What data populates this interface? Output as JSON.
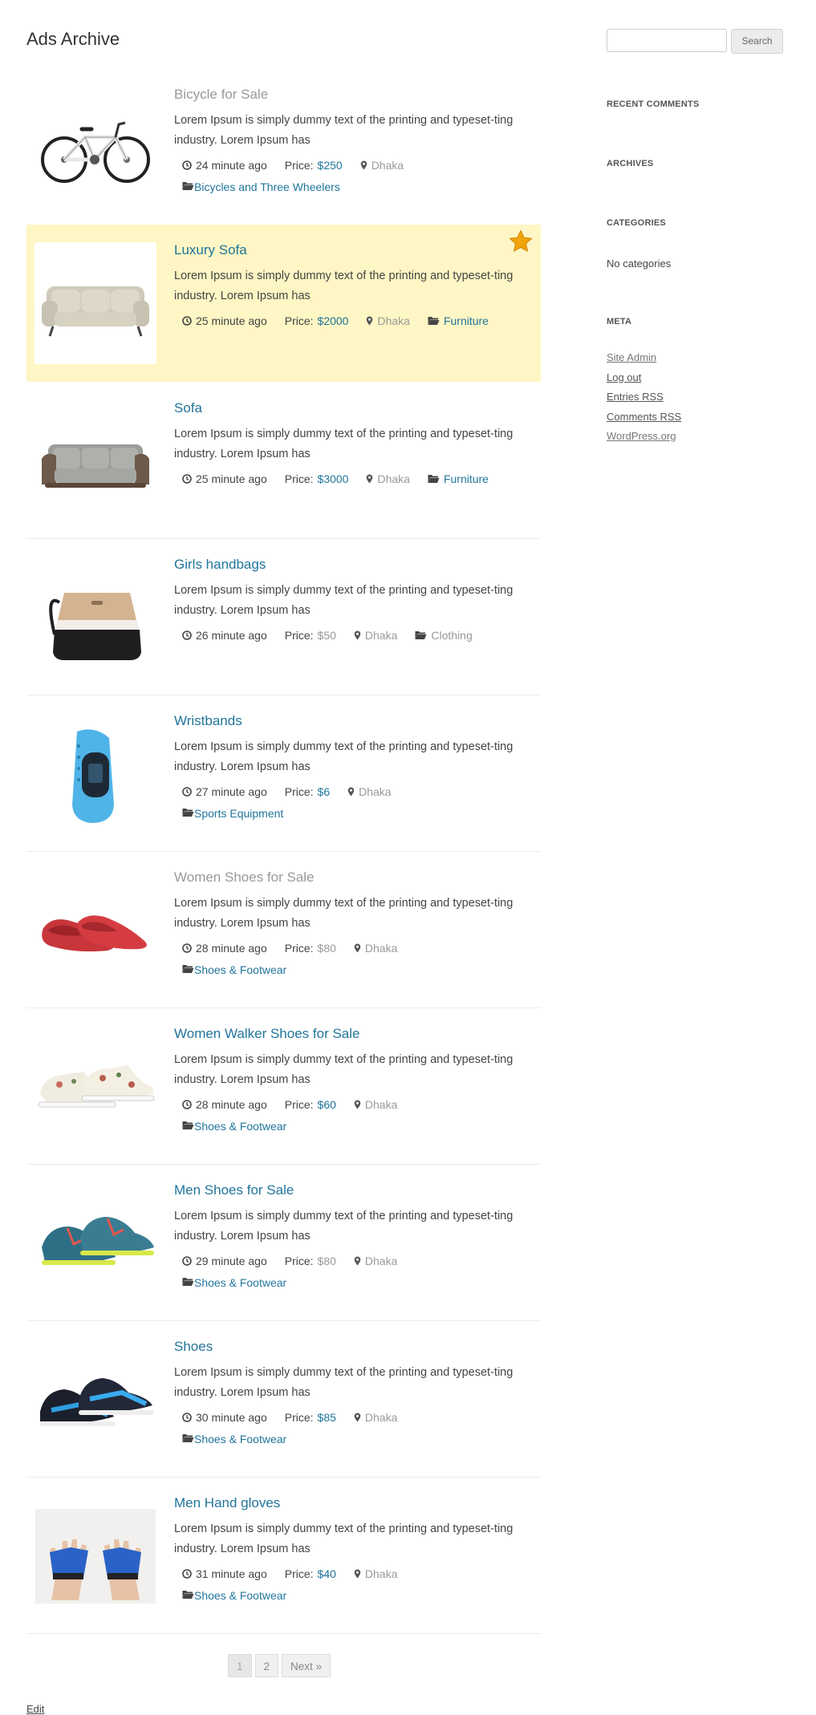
{
  "page": {
    "title": "Ads Archive",
    "edit_label": "Edit"
  },
  "colors": {
    "link": "#21759b",
    "featured_bg": "#fef6c4",
    "muted": "#999999",
    "star": "#f0a30a"
  },
  "ads": [
    {
      "title": "Bicycle for Sale",
      "title_muted": true,
      "image": "bicycle",
      "excerpt": "Lorem Ipsum is simply dummy text of the printing and typeset-ting industry. Lorem Ipsum has",
      "time": "24 minute ago",
      "price_label": "Price:",
      "price": "$250",
      "location": "Dhaka",
      "category": "Bicycles and Three Wheelers",
      "category_wrapped": true,
      "featured": false
    },
    {
      "title": "Luxury Sofa",
      "title_muted": false,
      "image": "sofa-beige",
      "excerpt": "Lorem Ipsum is simply dummy text of the printing and typeset-ting industry. Lorem Ipsum has",
      "time": "25 minute ago",
      "price_label": "Price:",
      "price": "$2000",
      "location": "Dhaka",
      "category": "Furniture",
      "category_wrapped": false,
      "featured": true
    },
    {
      "title": "Sofa",
      "title_muted": false,
      "image": "sofa-grey",
      "excerpt": "Lorem Ipsum is simply dummy text of the printing and typeset-ting industry. Lorem Ipsum has",
      "time": "25 minute ago",
      "price_label": "Price:",
      "price": "$3000",
      "location": "Dhaka",
      "category": "Furniture",
      "category_wrapped": false,
      "featured": false
    },
    {
      "title": "Girls handbags",
      "title_muted": false,
      "image": "handbag",
      "excerpt": "Lorem Ipsum is simply dummy text of the printing and typeset-ting industry. Lorem Ipsum has",
      "time": "26 minute ago",
      "price_label": "Price:",
      "price": "$50",
      "price_muted": true,
      "location": "Dhaka",
      "category": "Clothing",
      "category_muted": true,
      "category_wrapped": false,
      "featured": false
    },
    {
      "title": "Wristbands",
      "title_muted": false,
      "image": "wristband",
      "excerpt": "Lorem Ipsum is simply dummy text of the printing and typeset-ting industry. Lorem Ipsum has",
      "time": "27 minute ago",
      "price_label": "Price:",
      "price": "$6",
      "location": "Dhaka",
      "category": "Sports Equipment",
      "category_wrapped": true,
      "featured": false
    },
    {
      "title": "Women Shoes for Sale",
      "title_muted": true,
      "image": "shoes-red",
      "excerpt": "Lorem Ipsum is simply dummy text of the printing and typeset-ting industry. Lorem Ipsum has",
      "time": "28 minute ago",
      "price_label": "Price:",
      "price": "$80",
      "price_muted": true,
      "location": "Dhaka",
      "category": "Shoes & Footwear",
      "category_wrapped": true,
      "featured": false
    },
    {
      "title": "Women Walker Shoes for Sale",
      "title_muted": false,
      "image": "shoes-floral",
      "excerpt": "Lorem Ipsum is simply dummy text of the printing and typeset-ting industry. Lorem Ipsum has",
      "time": "28 minute ago",
      "price_label": "Price:",
      "price": "$60",
      "location": "Dhaka",
      "category": "Shoes & Footwear",
      "category_wrapped": true,
      "featured": false
    },
    {
      "title": "Men Shoes for Sale",
      "title_muted": false,
      "image": "shoes-sport",
      "excerpt": "Lorem Ipsum is simply dummy text of the printing and typeset-ting industry. Lorem Ipsum has",
      "time": "29 minute ago",
      "price_label": "Price:",
      "price": "$80",
      "price_muted": true,
      "location": "Dhaka",
      "category": "Shoes & Footwear",
      "category_wrapped": true,
      "featured": false
    },
    {
      "title": "Shoes",
      "title_muted": false,
      "image": "shoes-blue",
      "excerpt": "Lorem Ipsum is simply dummy text of the printing and typeset-ting industry. Lorem Ipsum has",
      "time": "30 minute ago",
      "price_label": "Price:",
      "price": "$85",
      "location": "Dhaka",
      "category": "Shoes & Footwear",
      "category_wrapped": true,
      "featured": false
    },
    {
      "title": "Men Hand gloves",
      "title_muted": false,
      "image": "gloves",
      "excerpt": "Lorem Ipsum is simply dummy text of the printing and typeset-ting industry. Lorem Ipsum has",
      "time": "31 minute ago",
      "price_label": "Price:",
      "price": "$40",
      "location": "Dhaka",
      "category": "Shoes & Footwear",
      "category_wrapped": true,
      "featured": false
    }
  ],
  "pagination": {
    "pages": [
      "1",
      "2"
    ],
    "current": "1",
    "next_label": "Next »"
  },
  "sidebar": {
    "search_button": "Search",
    "search_placeholder": "",
    "recent_comments_title": "Recent Comments",
    "archives_title": "Archives",
    "categories_title": "Categories",
    "categories_empty": "No categories",
    "meta_title": "Meta",
    "meta_links": [
      "Site Admin",
      "Log out",
      "Entries RSS",
      "Comments RSS",
      "WordPress.org"
    ]
  }
}
